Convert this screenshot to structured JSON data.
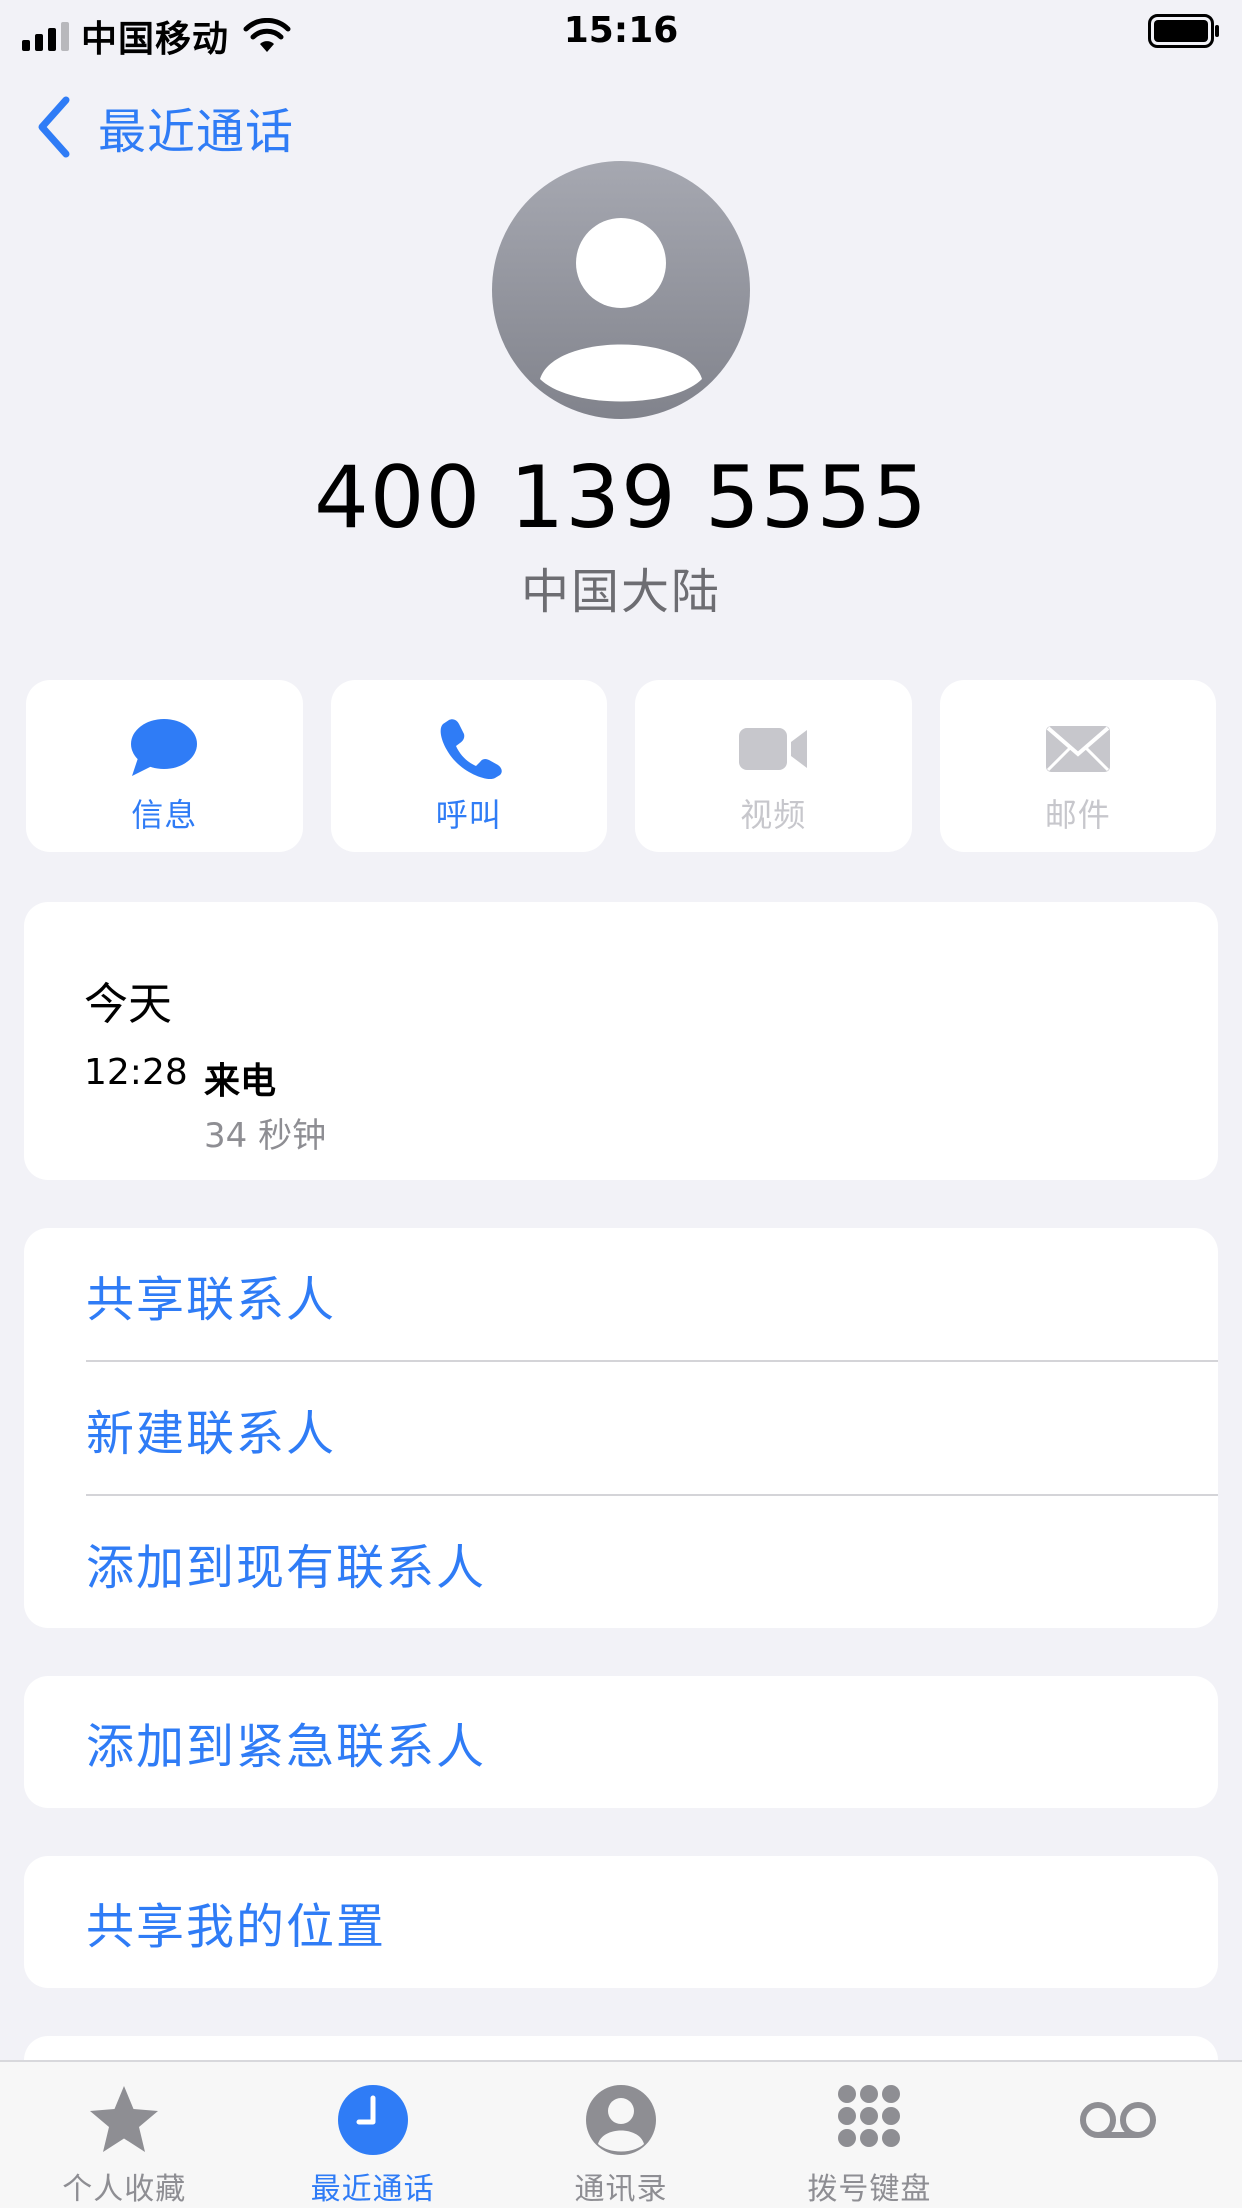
{
  "status_bar": {
    "carrier": "中国移动",
    "time": "15:16"
  },
  "nav": {
    "back_label": "最近通话"
  },
  "contact": {
    "number": "400 139 5555",
    "region": "中国大陆"
  },
  "actions": [
    {
      "label": "信息",
      "icon": "message-bubble-icon",
      "enabled": true
    },
    {
      "label": "呼叫",
      "icon": "phone-icon",
      "enabled": true
    },
    {
      "label": "视频",
      "icon": "video-camera-icon",
      "enabled": false
    },
    {
      "label": "邮件",
      "icon": "mail-envelope-icon",
      "enabled": false
    }
  ],
  "recents": {
    "day": "今天",
    "time": "12:28",
    "type": "来电",
    "duration": "34 秒钟"
  },
  "options": [
    {
      "label": "共享联系人"
    },
    {
      "label": "新建联系人"
    },
    {
      "label": "添加到现有联系人"
    }
  ],
  "emergency": {
    "label": "添加到紧急联系人"
  },
  "location": {
    "label": "共享我的位置"
  },
  "tabs": [
    {
      "label": "个人收藏",
      "icon": "star-icon",
      "active": false
    },
    {
      "label": "最近通话",
      "icon": "clock-icon",
      "active": true
    },
    {
      "label": "通讯录",
      "icon": "person-circle-icon",
      "active": false
    },
    {
      "label": "拨号键盘",
      "icon": "keypad-icon",
      "active": false
    },
    {
      "label": "语音留言",
      "icon": "voicemail-icon",
      "active": false
    }
  ],
  "colors": {
    "accent": "#2f7cf6",
    "background": "#f2f2f7",
    "disabled": "#c7c7cc",
    "secondary_text": "#8e8e93"
  }
}
